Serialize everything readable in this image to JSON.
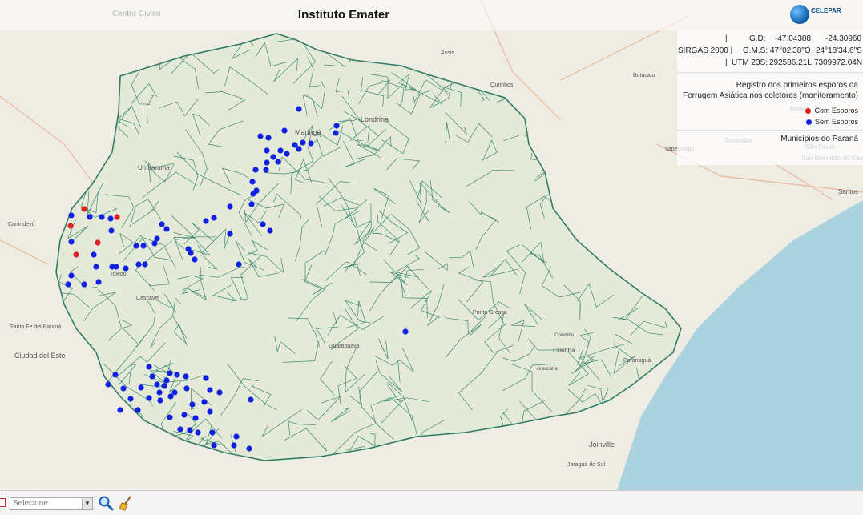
{
  "header": {
    "title": "Instituto Emater",
    "logo_text": "CELEPAR"
  },
  "coord_panel": {
    "gd_label": "G.D:",
    "gd_lon": "-47.04388",
    "gd_lat": "-24.30960",
    "datum_label": "SIRGAS 2000 |",
    "gms_label": "G.M.S:",
    "gms_lon": "47°02'38\"O",
    "gms_lat": "24°18'34.6\"S",
    "utm_label": "UTM 23S:",
    "utm_x": "292586.21L",
    "utm_y": "7309972.04N"
  },
  "legend": {
    "title_line1": "Registro dos primeiros esporos da",
    "title_line2": "Ferrugem Asiática nos coletores (monitoramento)",
    "items": [
      {
        "label": "Com Esporos",
        "color": "#e02020"
      },
      {
        "label": "Sem Esporos",
        "color": "#1020e0"
      }
    ],
    "layer": "Municípios do Paraná"
  },
  "map": {
    "labels": [
      "Centro Cívico",
      "Assis",
      "Ourinhos",
      "Botucatu",
      "Londrina",
      "Maringá",
      "Umuarama",
      "Toledo",
      "Cascavel",
      "Ponta Grossa",
      "Guarapuava",
      "Curitiba",
      "Paranaguá",
      "Joinville",
      "Jaraguá do Sul",
      "Ciudad del Este",
      "Santa Fe del Paraná",
      "Sorocaba",
      "São Paulo",
      "Santos",
      "Sao Bernardo do Campo",
      "Canindeyú",
      "Itapetininga",
      "Jundiaí",
      "Araucária",
      "Colombo"
    ],
    "river_colors": {
      "water": "#aad3df",
      "border": "#2f7d63"
    }
  },
  "toolbar": {
    "select_value": "Selecione",
    "search_icon": "search-icon",
    "clear_icon": "broom-icon"
  }
}
